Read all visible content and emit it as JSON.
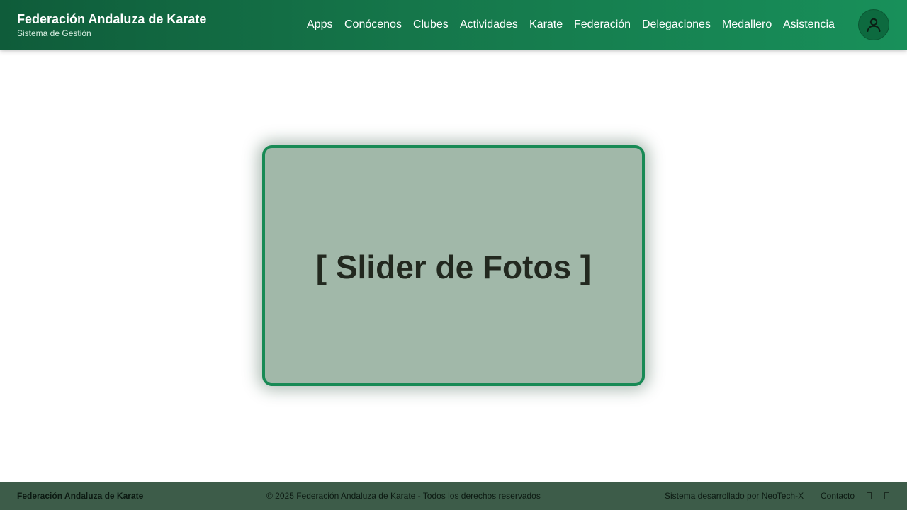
{
  "header": {
    "title": "Federación Andaluza de Karate",
    "subtitle": "Sistema de Gestión",
    "nav": [
      "Apps",
      "Conócenos",
      "Clubes",
      "Actividades",
      "Karate",
      "Federación",
      "Delegaciones",
      "Medallero",
      "Asistencia"
    ],
    "user_icon": "user-icon"
  },
  "main": {
    "slider_placeholder": "[ Slider de Fotos ]"
  },
  "footer": {
    "brand": "Federación Andaluza de Karate",
    "copyright": "© 2025 Federación Andaluza de Karate - Todos los derechos reservados",
    "developer": "Sistema desarrollado por NeoTech-X",
    "contact": "Contacto",
    "social_icons": [
      "social-icon",
      "social-icon"
    ]
  },
  "colors": {
    "header_dark": "#0f5c3a",
    "header_light": "#18905a",
    "slider_bg": "#a1b8a9",
    "slider_border": "#188a55",
    "footer_bg": "#3d5c49"
  }
}
